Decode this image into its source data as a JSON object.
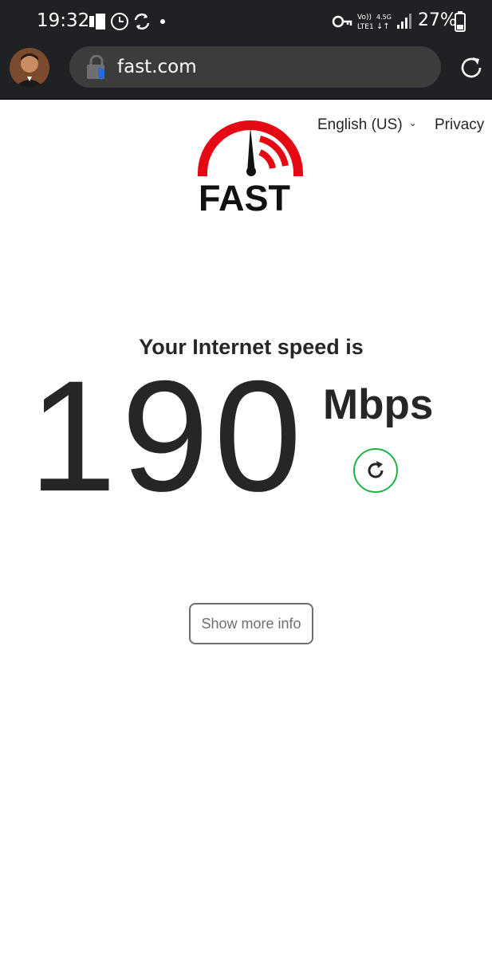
{
  "status_bar": {
    "time": "19:32",
    "battery_percent": "27%",
    "network_volte": "Vo))",
    "network_lte": "LTE1",
    "network_speed": "4.5G",
    "left_icons": [
      "cast-icon",
      "clock-icon",
      "sync-icon",
      "dot-icon"
    ],
    "right_icons": [
      "key-icon",
      "volte-icon",
      "data-arrows-icon",
      "signal-icon",
      "battery-icon"
    ]
  },
  "browser": {
    "url": "fast.com",
    "icons": [
      "avatar",
      "lock-icon",
      "reload-icon"
    ]
  },
  "header": {
    "language": "English (US)",
    "privacy": "Privacy"
  },
  "logo": {
    "text": "FAST",
    "accent_color": "#e50914"
  },
  "result": {
    "caption": "Your Internet speed is",
    "speed": "190",
    "unit": "Mbps",
    "retest_icon": "refresh-icon",
    "retest_color": "#1fb344"
  },
  "actions": {
    "show_more": "Show more info"
  }
}
